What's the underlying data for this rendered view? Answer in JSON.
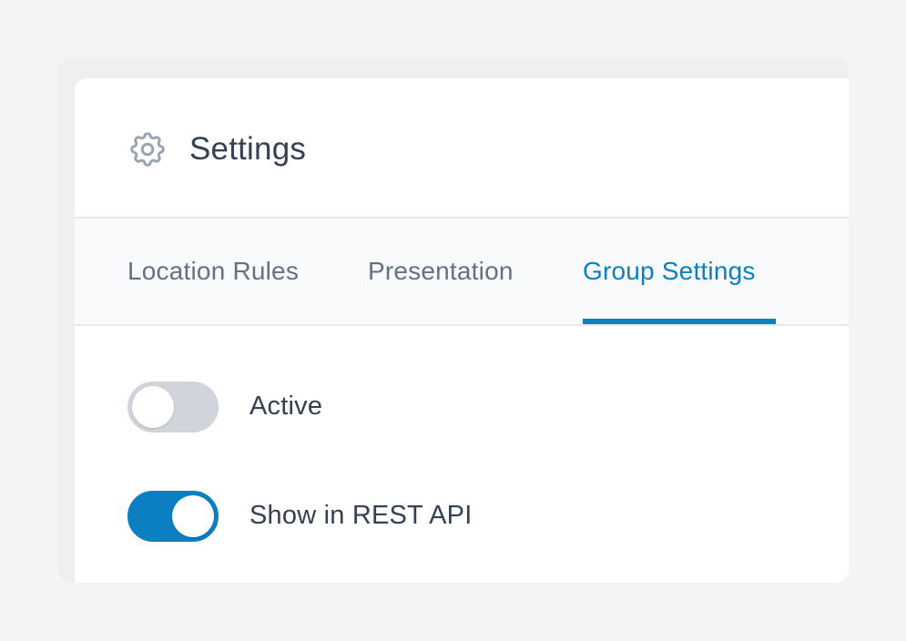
{
  "header": {
    "title": "Settings",
    "icon": "gear-icon"
  },
  "tabs": [
    {
      "label": "Location Rules",
      "active": false
    },
    {
      "label": "Presentation",
      "active": false
    },
    {
      "label": "Group Settings",
      "active": true
    }
  ],
  "settings": [
    {
      "label": "Active",
      "enabled": false
    },
    {
      "label": "Show in REST API",
      "enabled": true
    }
  ],
  "colors": {
    "accent": "#0b7fc2",
    "toggle_off": "#d1d5db",
    "text": "#344054",
    "muted_text": "#667085"
  }
}
